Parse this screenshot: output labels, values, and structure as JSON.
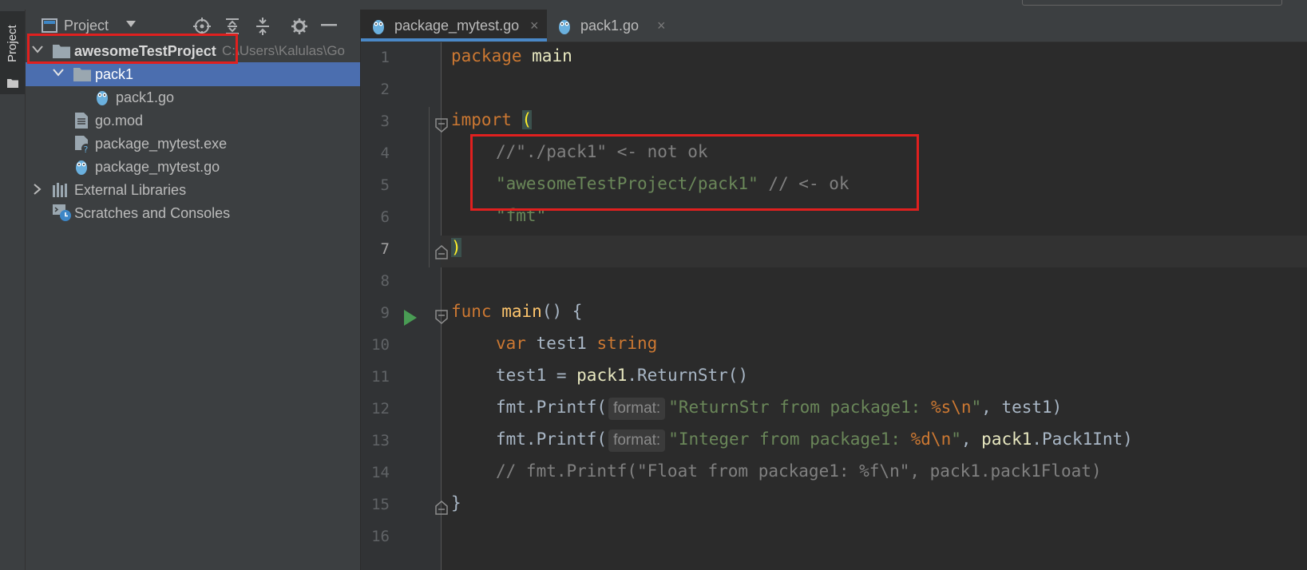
{
  "colors": {
    "selection": "#4b6eaf",
    "keyword": "#cc7832",
    "function": "#ffc66d",
    "string": "#6a8759",
    "comment": "#808080",
    "highlight_box": "#e0201f",
    "run_icon": "#499c54"
  },
  "tool_window": {
    "tab_label": "Project"
  },
  "project_panel": {
    "title": "Project",
    "header_icons": [
      "locate-icon",
      "expand-all-icon",
      "collapse-all-icon",
      "gear-icon",
      "minimize-icon"
    ],
    "tree": {
      "root": {
        "label": "awesomeTestProject",
        "path": "C:\\Users\\Kalulas\\Go"
      },
      "pack1_folder": {
        "label": "pack1"
      },
      "pack1_go": {
        "label": "pack1.go"
      },
      "go_mod": {
        "label": "go.mod"
      },
      "package_exe": {
        "label": "package_mytest.exe"
      },
      "package_go": {
        "label": "package_mytest.go"
      },
      "external_libraries": {
        "label": "External Libraries"
      },
      "scratches": {
        "label": "Scratches and Consoles"
      }
    }
  },
  "editor": {
    "tabs": [
      {
        "label": "package_mytest.go",
        "close": "×"
      },
      {
        "label": "pack1.go",
        "close": "×"
      }
    ],
    "line_numbers": [
      "1",
      "2",
      "3",
      "4",
      "5",
      "6",
      "7",
      "8",
      "9",
      "10",
      "11",
      "12",
      "13",
      "14",
      "15",
      "16"
    ],
    "code": {
      "l1_kw": "package",
      "l1_rest": " main",
      "l3_kw": "import",
      "l3_paren": "(",
      "l4_comment": "//\"./pack1\" <- not ok",
      "l5_str": "\"awesomeTestProject/pack1\"",
      "l5_comment": " // <- ok",
      "l6_str": "\"fmt\"",
      "l7_paren": ")",
      "l9_kw": "func",
      "l9_fn": "main",
      "l9_rest": "() {",
      "l10_kw": "var",
      "l10_ident": " test1 ",
      "l10_type": "string",
      "l11_a": "test1 = ",
      "l11_pkg": "pack1",
      "l11_b": ".ReturnStr()",
      "l12_call": "fmt.Printf(",
      "l12_hint": "format:",
      "l12_str_a": "\"ReturnStr from package1: ",
      "l12_verb": "%s\\n",
      "l12_str_b": "\"",
      "l12_rest": ", test1)",
      "l13_call": "fmt.Printf(",
      "l13_hint": "format:",
      "l13_str_a": "\"Integer from package1: ",
      "l13_verb": "%d\\n",
      "l13_str_b": "\"",
      "l13_sep": ", ",
      "l13_pkg": "pack1",
      "l13_rest": ".Pack1Int)",
      "l14_comment": "// fmt.Printf(\"Float from package1: %f\\n\", pack1.pack1Float)",
      "l15_brace": "}"
    }
  }
}
